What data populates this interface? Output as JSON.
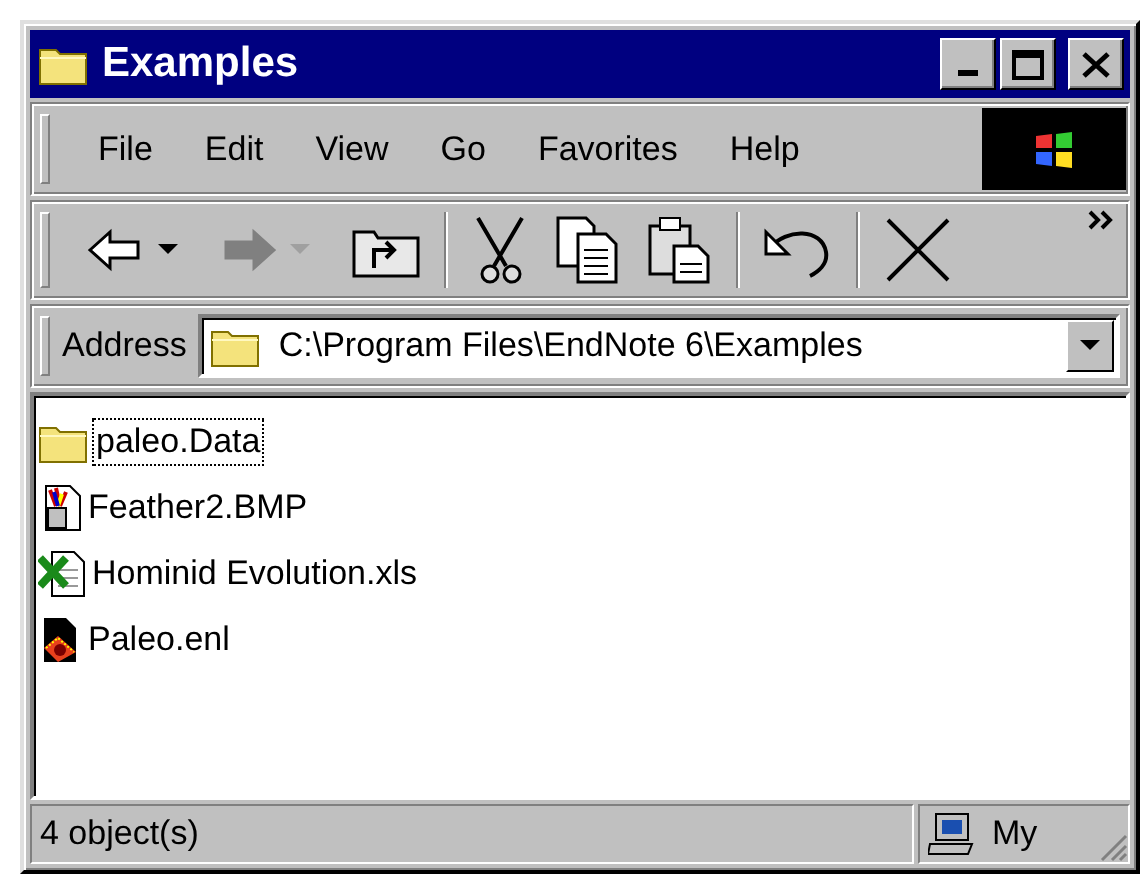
{
  "window": {
    "title": "Examples",
    "controls": [
      {
        "kind": "minimize"
      },
      {
        "kind": "maximize"
      },
      {
        "kind": "close"
      }
    ]
  },
  "menu": [
    {
      "label": "File"
    },
    {
      "label": "Edit"
    },
    {
      "label": "View"
    },
    {
      "label": "Go"
    },
    {
      "label": "Favorites"
    },
    {
      "label": "Help"
    }
  ],
  "toolbar": [
    {
      "kind": "back",
      "disabled": false
    },
    {
      "kind": "forward",
      "disabled": true
    },
    {
      "kind": "up",
      "disabled": false
    },
    {
      "kind": "separator"
    },
    {
      "kind": "cut",
      "disabled": false
    },
    {
      "kind": "copy",
      "disabled": false
    },
    {
      "kind": "paste",
      "disabled": false
    },
    {
      "kind": "separator"
    },
    {
      "kind": "undo",
      "disabled": false
    },
    {
      "kind": "separator"
    },
    {
      "kind": "delete",
      "disabled": false
    },
    {
      "kind": "more"
    }
  ],
  "address": {
    "label": "Address",
    "value": "C:\\Program Files\\EndNote 6\\Examples"
  },
  "files": [
    {
      "name": "paleo.Data",
      "kind": "folder",
      "focused": true
    },
    {
      "name": "Feather2.BMP",
      "kind": "bitmap",
      "focused": false
    },
    {
      "name": "Hominid Evolution.xls",
      "kind": "spreadsheet",
      "focused": false
    },
    {
      "name": "Paleo.enl",
      "kind": "endnote",
      "focused": false
    }
  ],
  "status_bar": {
    "count": "4 object(s)",
    "zone": "My"
  }
}
